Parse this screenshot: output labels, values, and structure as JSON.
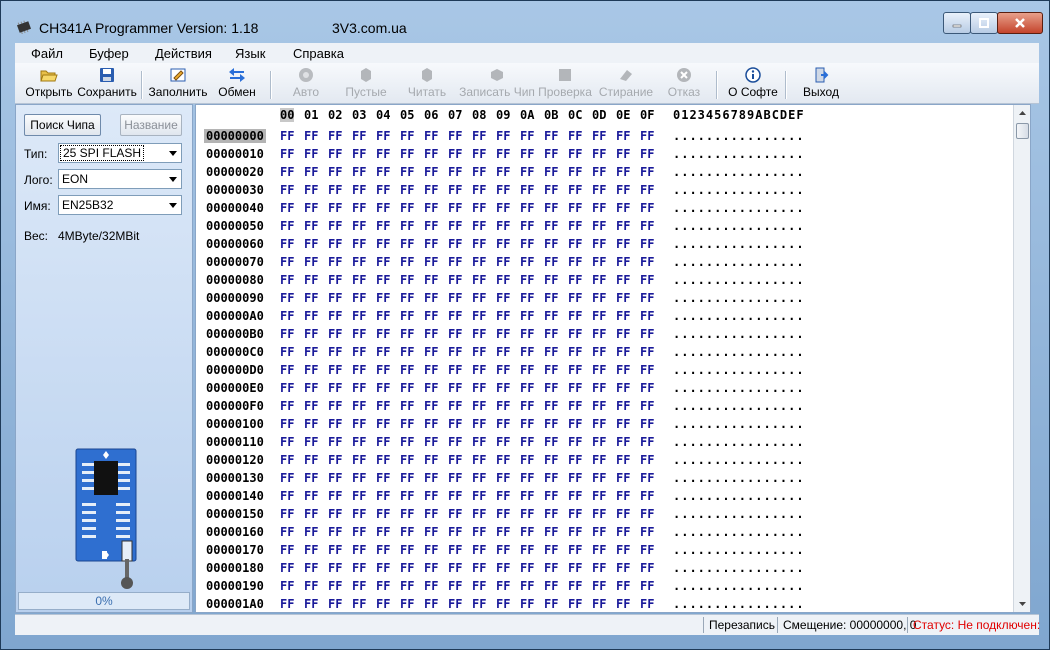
{
  "window": {
    "title": "CH341A Programmer Version: 1.18",
    "site": "3V3.com.ua"
  },
  "menu": [
    "Файл",
    "Буфер",
    "Действия",
    "Язык",
    "Справка"
  ],
  "toolbar": [
    {
      "label": "Открыть",
      "icon": "folder-open-icon",
      "enabled": true
    },
    {
      "label": "Сохранить",
      "icon": "floppy-disk-icon",
      "enabled": true
    },
    {
      "label": "Заполнить",
      "icon": "fill-icon",
      "enabled": true
    },
    {
      "label": "Обмен",
      "icon": "swap-arrows-icon",
      "enabled": true
    },
    {
      "label": "Авто",
      "icon": "auto-icon",
      "enabled": false
    },
    {
      "label": "Пустые",
      "icon": "blank-check-icon",
      "enabled": false
    },
    {
      "label": "Читать",
      "icon": "read-icon",
      "enabled": false
    },
    {
      "label": "Записать Чип",
      "icon": "write-chip-icon",
      "enabled": false
    },
    {
      "label": "Проверка",
      "icon": "verify-icon",
      "enabled": false
    },
    {
      "label": "Стирание",
      "icon": "erase-icon",
      "enabled": false
    },
    {
      "label": "Отказ",
      "icon": "cancel-icon",
      "enabled": false
    },
    {
      "label": "О Софте",
      "icon": "info-icon",
      "enabled": true
    },
    {
      "label": "Выход",
      "icon": "exit-icon",
      "enabled": true
    }
  ],
  "left_panel": {
    "search_button": "Поиск Чипа",
    "name_button": "Название",
    "type_label": "Тип:",
    "type_value": "25 SPI FLASH",
    "logo_label": "Лого:",
    "logo_value": "EON",
    "name_label": "Имя:",
    "name_value": "EN25B32",
    "size_label": "Вес:",
    "size_value": "4MByte/32MBit",
    "progress_text": "0%",
    "progress_value": 0
  },
  "hex": {
    "columns": [
      "00",
      "01",
      "02",
      "03",
      "04",
      "05",
      "06",
      "07",
      "08",
      "09",
      "0A",
      "0B",
      "0C",
      "0D",
      "0E",
      "0F"
    ],
    "ascii_header": "0123456789ABCDEF",
    "addresses": [
      "00000000",
      "00000010",
      "00000020",
      "00000030",
      "00000040",
      "00000050",
      "00000060",
      "00000070",
      "00000080",
      "00000090",
      "000000A0",
      "000000B0",
      "000000C0",
      "000000D0",
      "000000E0",
      "000000F0",
      "00000100",
      "00000110",
      "00000120",
      "00000130",
      "00000140",
      "00000150",
      "00000160",
      "00000170",
      "00000180",
      "00000190",
      "000001A0"
    ],
    "byte_value": "FF",
    "ascii_row": "................"
  },
  "status": {
    "mode": "Перезапись",
    "offset": "Смещение: 00000000, 0",
    "status_text": "Статус: Не подключен:",
    "status_color": "#e00000"
  },
  "colors": {
    "hex_bytes": "#1a1a9a",
    "chip_board": "#2f6fd0"
  }
}
